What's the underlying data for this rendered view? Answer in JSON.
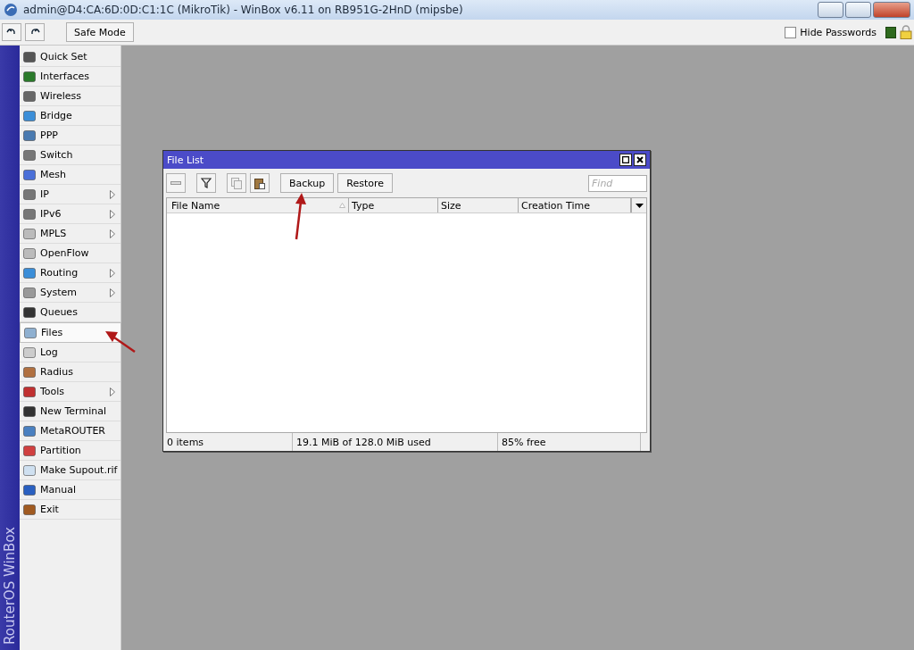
{
  "window": {
    "title": "admin@D4:CA:6D:0D:C1:1C (MikroTik) - WinBox v6.11 on RB951G-2HnD (mipsbe)"
  },
  "toolbar": {
    "safe_mode": "Safe Mode",
    "hide_passwords": {
      "label": "Hide Passwords",
      "checked": false
    }
  },
  "sidebar": {
    "brand": "RouterOS WinBox",
    "items": [
      {
        "label": "Quick Set",
        "submenu": false,
        "selected": false
      },
      {
        "label": "Interfaces",
        "submenu": false,
        "selected": false
      },
      {
        "label": "Wireless",
        "submenu": false,
        "selected": false
      },
      {
        "label": "Bridge",
        "submenu": false,
        "selected": false
      },
      {
        "label": "PPP",
        "submenu": false,
        "selected": false
      },
      {
        "label": "Switch",
        "submenu": false,
        "selected": false
      },
      {
        "label": "Mesh",
        "submenu": false,
        "selected": false
      },
      {
        "label": "IP",
        "submenu": true,
        "selected": false
      },
      {
        "label": "IPv6",
        "submenu": true,
        "selected": false
      },
      {
        "label": "MPLS",
        "submenu": true,
        "selected": false
      },
      {
        "label": "OpenFlow",
        "submenu": false,
        "selected": false
      },
      {
        "label": "Routing",
        "submenu": true,
        "selected": false
      },
      {
        "label": "System",
        "submenu": true,
        "selected": false
      },
      {
        "label": "Queues",
        "submenu": false,
        "selected": false
      },
      {
        "label": "Files",
        "submenu": false,
        "selected": true
      },
      {
        "label": "Log",
        "submenu": false,
        "selected": false
      },
      {
        "label": "Radius",
        "submenu": false,
        "selected": false
      },
      {
        "label": "Tools",
        "submenu": true,
        "selected": false
      },
      {
        "label": "New Terminal",
        "submenu": false,
        "selected": false
      },
      {
        "label": "MetaROUTER",
        "submenu": false,
        "selected": false
      },
      {
        "label": "Partition",
        "submenu": false,
        "selected": false
      },
      {
        "label": "Make Supout.rif",
        "submenu": false,
        "selected": false
      },
      {
        "label": "Manual",
        "submenu": false,
        "selected": false
      },
      {
        "label": "Exit",
        "submenu": false,
        "selected": false
      }
    ]
  },
  "file_list": {
    "title": "File List",
    "buttons": [
      "Backup",
      "Restore"
    ],
    "search": {
      "placeholder": "Find"
    },
    "table": {
      "columns": [
        "File Name",
        "Type",
        "Size",
        "Creation Time"
      ]
    },
    "status_bar": [
      "0 items",
      "19.1 MiB of 128.0 MiB used",
      "85% free"
    ]
  }
}
